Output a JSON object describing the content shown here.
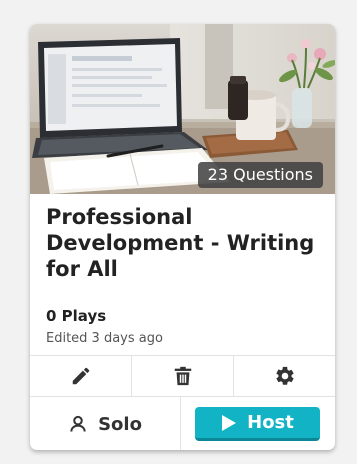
{
  "quiz_card": {
    "question_count_label": "23 Questions",
    "title": "Professional Development - Writing for All",
    "plays_label": "0 Plays",
    "edited_label": "Edited 3 days ago"
  },
  "actions": {
    "edit_icon": "pencil-icon",
    "delete_icon": "trash-icon",
    "settings_icon": "gear-icon",
    "solo_label": "Solo",
    "solo_icon": "person-icon",
    "host_label": "Host",
    "host_icon": "play-icon"
  },
  "colors": {
    "host_button": "#11b3c4",
    "icon": "#333333",
    "badge_background": "#404040"
  }
}
